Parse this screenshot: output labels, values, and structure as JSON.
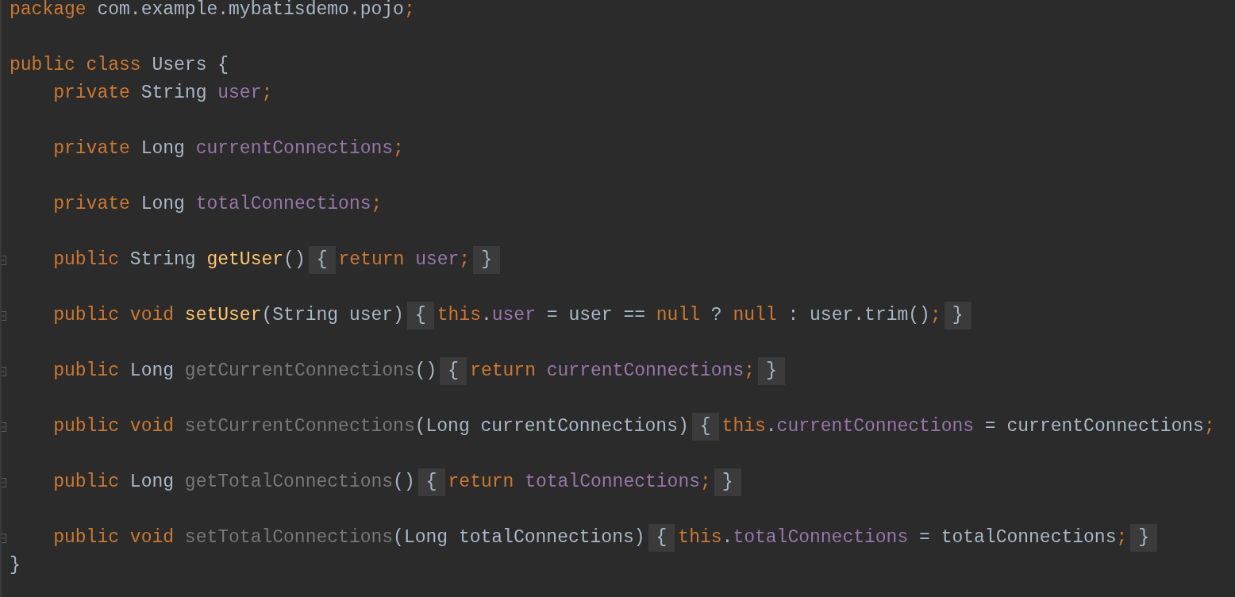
{
  "editor": {
    "lines": [
      {
        "foldable": false,
        "tokens": [
          {
            "kind": "keyword",
            "text": "package"
          },
          {
            "kind": "plain",
            "text": " com.example.mybatisdemo.pojo"
          },
          {
            "kind": "punct",
            "text": ";"
          }
        ]
      },
      {
        "foldable": false
      },
      {
        "foldable": false,
        "tokens": [
          {
            "kind": "keyword",
            "text": "public class"
          },
          {
            "kind": "plain",
            "text": " Users {"
          }
        ]
      },
      {
        "foldable": false,
        "tokens": [
          {
            "kind": "keyword",
            "text": "    private"
          },
          {
            "kind": "plain",
            "text": " String "
          },
          {
            "kind": "field",
            "text": "user"
          },
          {
            "kind": "punct",
            "text": ";"
          }
        ]
      },
      {
        "foldable": false
      },
      {
        "foldable": false,
        "tokens": [
          {
            "kind": "keyword",
            "text": "    private"
          },
          {
            "kind": "plain",
            "text": " Long "
          },
          {
            "kind": "field",
            "text": "currentConnections"
          },
          {
            "kind": "punct",
            "text": ";"
          }
        ]
      },
      {
        "foldable": false
      },
      {
        "foldable": false,
        "tokens": [
          {
            "kind": "keyword",
            "text": "    private"
          },
          {
            "kind": "plain",
            "text": " Long "
          },
          {
            "kind": "field",
            "text": "totalConnections"
          },
          {
            "kind": "punct",
            "text": ";"
          }
        ]
      },
      {
        "foldable": false
      },
      {
        "foldable": true,
        "tokens": [
          {
            "kind": "keyword",
            "text": "    public"
          },
          {
            "kind": "plain",
            "text": " String "
          },
          {
            "kind": "method",
            "text": "getUser"
          },
          {
            "kind": "plain",
            "text": "()"
          },
          {
            "kind": "fold",
            "text": "{"
          },
          {
            "kind": "keyword",
            "text": "return "
          },
          {
            "kind": "field",
            "text": "user"
          },
          {
            "kind": "punct",
            "text": ";"
          },
          {
            "kind": "fold",
            "text": "}"
          }
        ]
      },
      {
        "foldable": false
      },
      {
        "foldable": true,
        "tokens": [
          {
            "kind": "keyword",
            "text": "    public void "
          },
          {
            "kind": "method",
            "text": "setUser"
          },
          {
            "kind": "plain",
            "text": "(String user)"
          },
          {
            "kind": "fold",
            "text": "{"
          },
          {
            "kind": "keyword",
            "text": "this"
          },
          {
            "kind": "plain",
            "text": "."
          },
          {
            "kind": "field",
            "text": "user"
          },
          {
            "kind": "plain",
            "text": " = user == "
          },
          {
            "kind": "keyword",
            "text": "null"
          },
          {
            "kind": "plain",
            "text": " ? "
          },
          {
            "kind": "keyword",
            "text": "null"
          },
          {
            "kind": "plain",
            "text": " : user.trim()"
          },
          {
            "kind": "punct",
            "text": ";"
          },
          {
            "kind": "fold",
            "text": "}"
          }
        ]
      },
      {
        "foldable": false
      },
      {
        "foldable": true,
        "tokens": [
          {
            "kind": "keyword",
            "text": "    public"
          },
          {
            "kind": "plain",
            "text": " Long "
          },
          {
            "kind": "unused",
            "text": "getCurrentConnections"
          },
          {
            "kind": "plain",
            "text": "()"
          },
          {
            "kind": "fold",
            "text": "{"
          },
          {
            "kind": "keyword",
            "text": "return "
          },
          {
            "kind": "field",
            "text": "currentConnections"
          },
          {
            "kind": "punct",
            "text": ";"
          },
          {
            "kind": "fold",
            "text": "}"
          }
        ]
      },
      {
        "foldable": false
      },
      {
        "foldable": true,
        "tokens": [
          {
            "kind": "keyword",
            "text": "    public void "
          },
          {
            "kind": "unused",
            "text": "setCurrentConnections"
          },
          {
            "kind": "plain",
            "text": "(Long currentConnections)"
          },
          {
            "kind": "fold",
            "text": "{"
          },
          {
            "kind": "keyword",
            "text": "this"
          },
          {
            "kind": "plain",
            "text": "."
          },
          {
            "kind": "field",
            "text": "currentConnections"
          },
          {
            "kind": "plain",
            "text": " = currentConnections"
          },
          {
            "kind": "punct",
            "text": ";"
          }
        ]
      },
      {
        "foldable": false
      },
      {
        "foldable": true,
        "tokens": [
          {
            "kind": "keyword",
            "text": "    public"
          },
          {
            "kind": "plain",
            "text": " Long "
          },
          {
            "kind": "unused",
            "text": "getTotalConnections"
          },
          {
            "kind": "plain",
            "text": "()"
          },
          {
            "kind": "fold",
            "text": "{"
          },
          {
            "kind": "keyword",
            "text": "return "
          },
          {
            "kind": "field",
            "text": "totalConnections"
          },
          {
            "kind": "punct",
            "text": ";"
          },
          {
            "kind": "fold",
            "text": "}"
          }
        ]
      },
      {
        "foldable": false
      },
      {
        "foldable": true,
        "tokens": [
          {
            "kind": "keyword",
            "text": "    public void "
          },
          {
            "kind": "unused",
            "text": "setTotalConnections"
          },
          {
            "kind": "plain",
            "text": "(Long totalConnections)"
          },
          {
            "kind": "fold",
            "text": "{"
          },
          {
            "kind": "keyword",
            "text": "this"
          },
          {
            "kind": "plain",
            "text": "."
          },
          {
            "kind": "field",
            "text": "totalConnections"
          },
          {
            "kind": "plain",
            "text": " = totalConnections"
          },
          {
            "kind": "punct",
            "text": ";"
          },
          {
            "kind": "fold",
            "text": "}"
          }
        ]
      },
      {
        "foldable": false,
        "tokens": [
          {
            "kind": "plain",
            "text": "}"
          }
        ]
      }
    ]
  }
}
